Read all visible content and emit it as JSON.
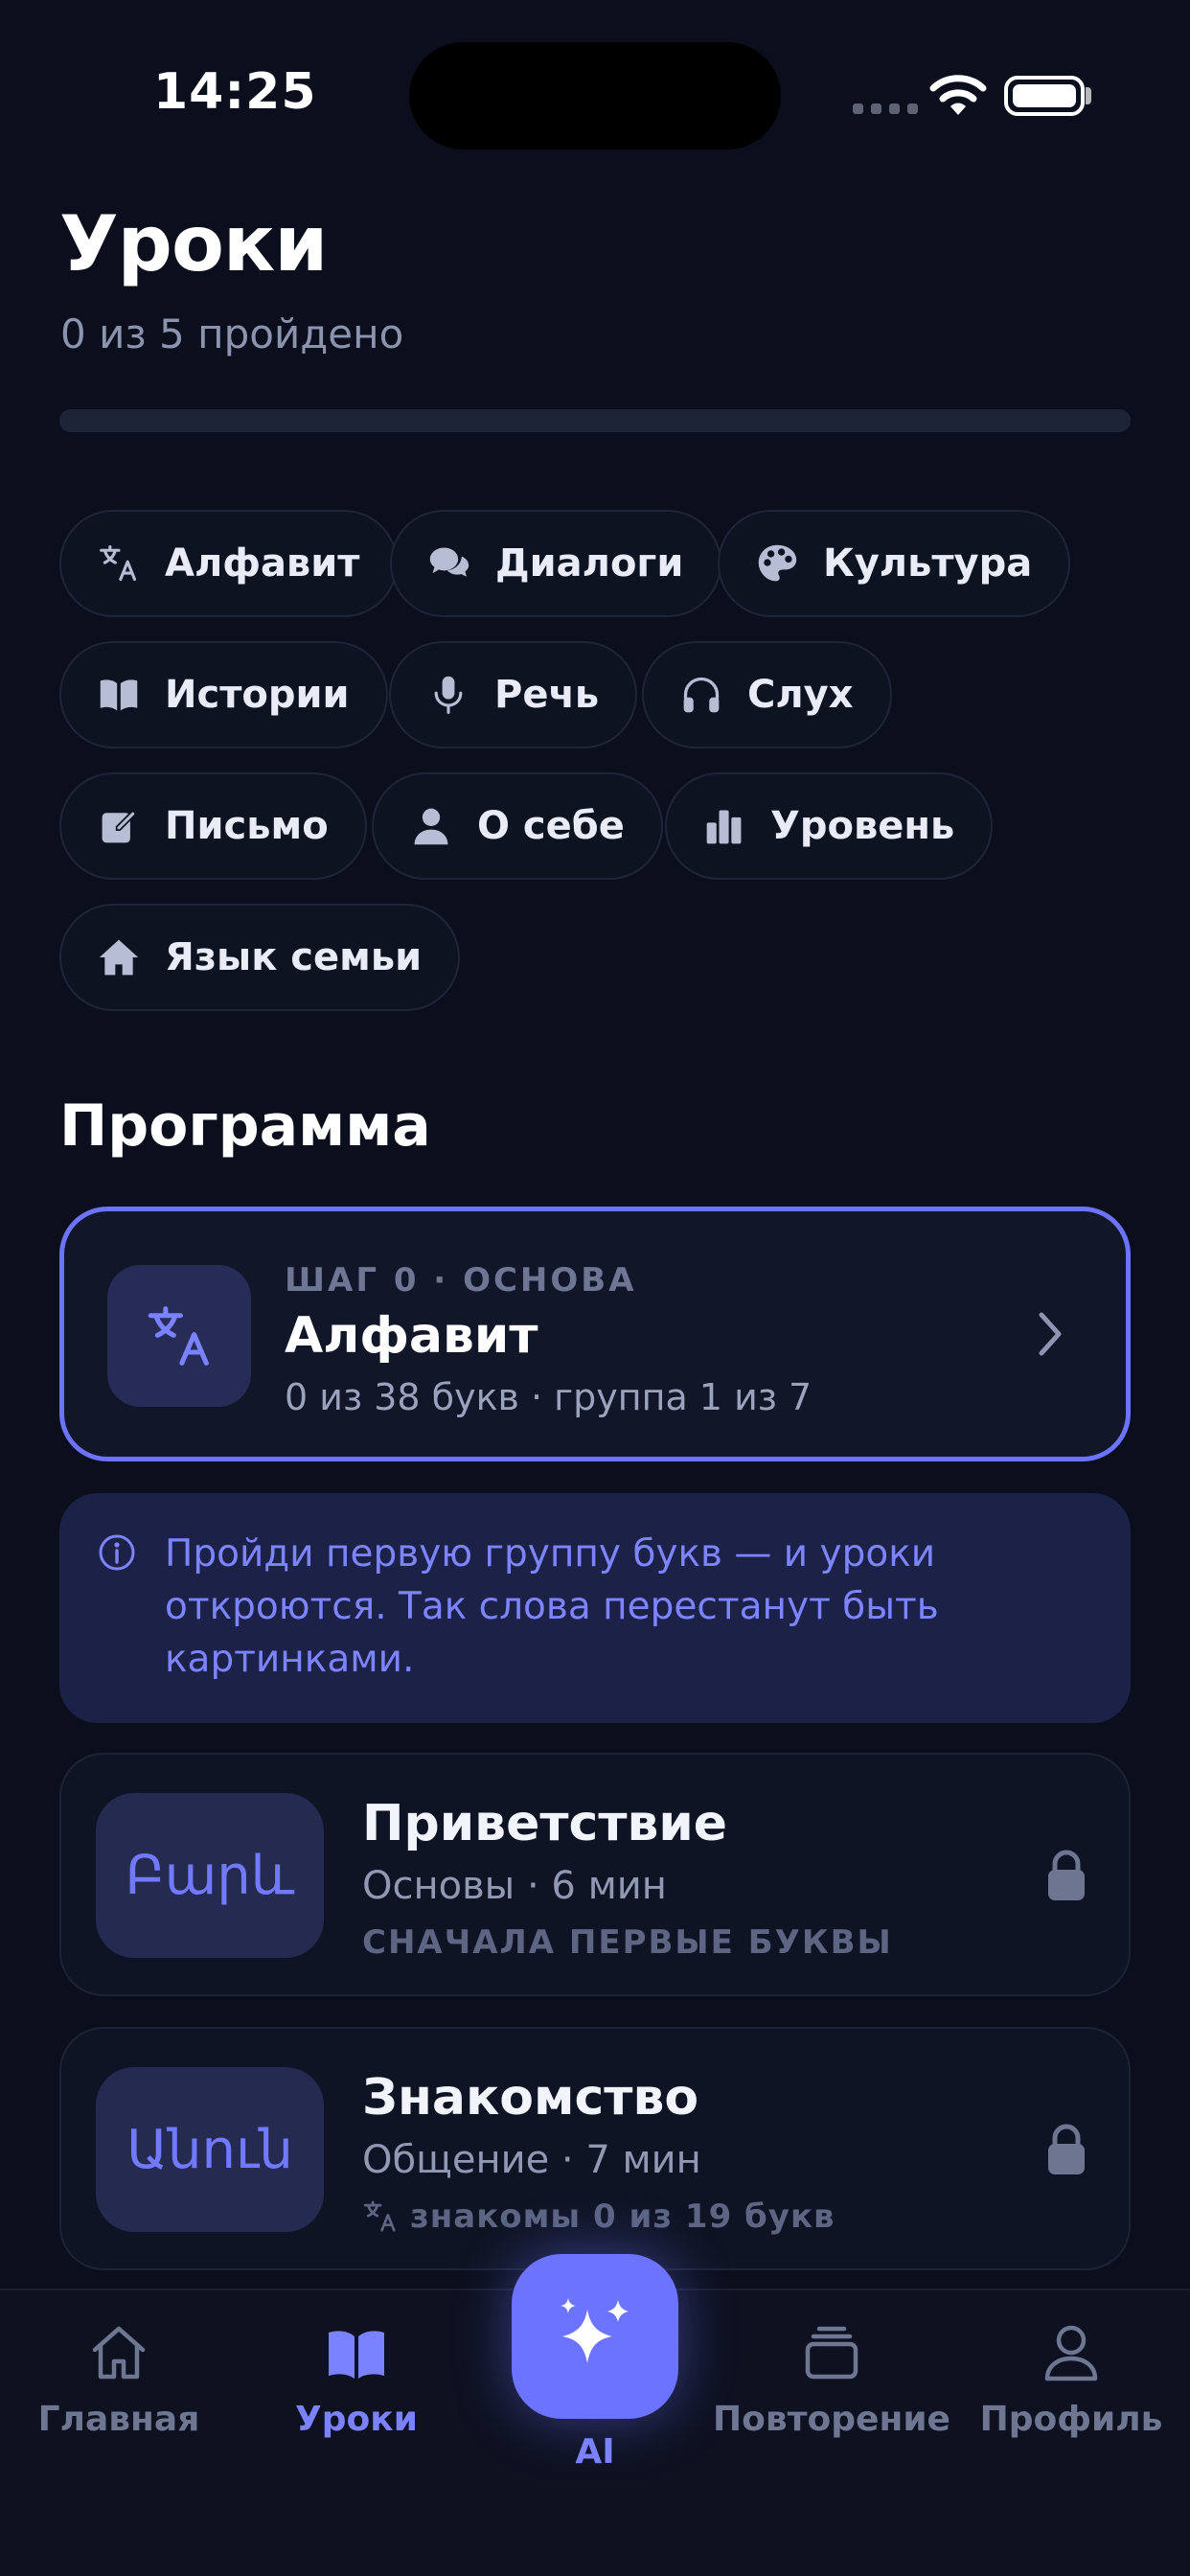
{
  "status_bar": {
    "time": "14:25"
  },
  "header": {
    "title": "Уроки",
    "subtitle": "0 из 5 пройдено",
    "progress_fraction": 0
  },
  "categories": [
    {
      "label": "Алфавит",
      "icon": "translate-icon"
    },
    {
      "label": "Диалоги",
      "icon": "chat-bubbles-icon"
    },
    {
      "label": "Культура",
      "icon": "palette-icon"
    },
    {
      "label": "Истории",
      "icon": "book-icon"
    },
    {
      "label": "Речь",
      "icon": "microphone-icon"
    },
    {
      "label": "Слух",
      "icon": "headphones-icon"
    },
    {
      "label": "Письмо",
      "icon": "pencil-square-icon"
    },
    {
      "label": "О себе",
      "icon": "person-icon"
    },
    {
      "label": "Уровень",
      "icon": "bar-chart-icon"
    },
    {
      "label": "Язык семьи",
      "icon": "house-icon"
    }
  ],
  "program": {
    "title": "Программа",
    "alphabet_card": {
      "kicker": "ШАГ 0 · ОСНОВА",
      "title": "Алфавит",
      "meta": "0 из 38 букв · группа 1 из 7"
    },
    "info": "Пройди первую группу букв — и уроки откроются. Так слова перестанут быть картинками.",
    "lessons": [
      {
        "thumb": "Բարև",
        "title": "Приветствие",
        "meta": "Основы · 6 мин",
        "note": "СНАЧАЛА ПЕРВЫЕ БУКВЫ"
      },
      {
        "thumb": "Անուն",
        "title": "Знакомство",
        "meta": "Общение · 7 мин",
        "note": "знакомы 0 из 19 букв"
      }
    ]
  },
  "tabbar": {
    "home": "Главная",
    "lessons": "Уроки",
    "ai": "AI",
    "review": "Повторение",
    "profile": "Профиль",
    "active_color": "#7b82ff",
    "inactive_color": "#6e7692"
  },
  "colors": {
    "accent": "#6b73ff",
    "background": "#0b0f1d"
  }
}
